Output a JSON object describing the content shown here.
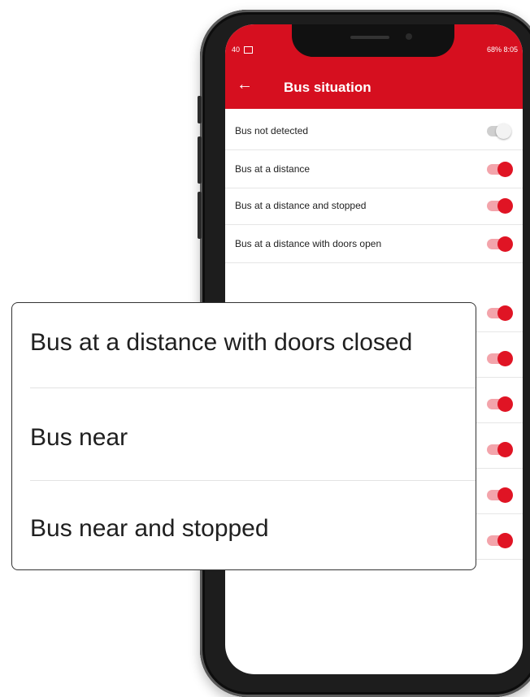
{
  "status_bar": {
    "left": "40",
    "right": "68% 8:05"
  },
  "appbar": {
    "title": "Bus situation"
  },
  "settings": [
    {
      "label": "Bus not detected",
      "enabled": false
    },
    {
      "label": "Bus at a distance",
      "enabled": true
    },
    {
      "label": "Bus at a distance and stopped",
      "enabled": true
    },
    {
      "label": "Bus at a distance with doors open",
      "enabled": true
    },
    {
      "label": "",
      "enabled": true
    },
    {
      "label": "",
      "enabled": true
    },
    {
      "label": "",
      "enabled": true
    },
    {
      "label": "",
      "enabled": true
    },
    {
      "label": "",
      "enabled": true
    },
    {
      "label": "",
      "enabled": true
    }
  ],
  "callout": {
    "items": [
      "Bus at a distance with doors closed",
      "Bus near",
      "Bus near and stopped"
    ]
  },
  "colors": {
    "accent": "#d60f1f",
    "toggle_track_on": "#f3a4ab",
    "toggle_track_off": "#cfcfcf"
  }
}
